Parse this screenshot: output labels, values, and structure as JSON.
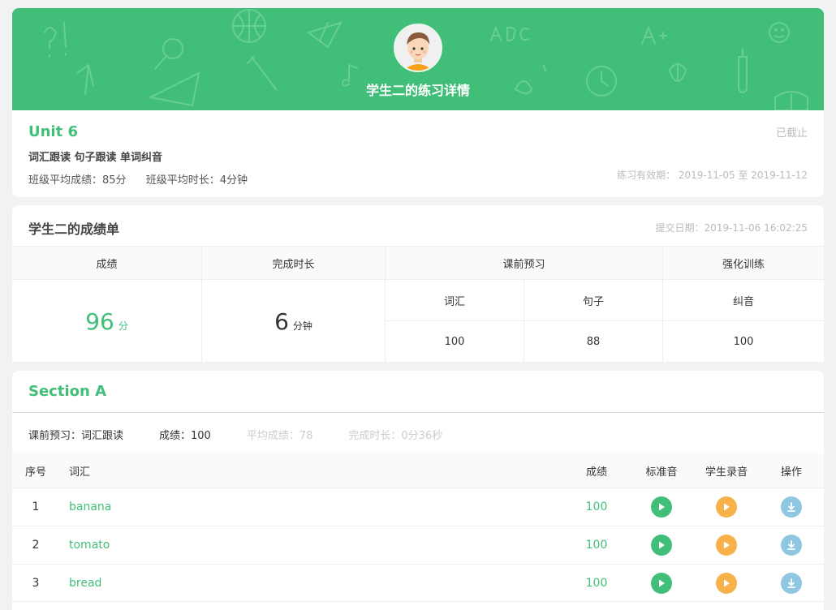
{
  "header": {
    "title": "学生二的练习详情"
  },
  "unit": {
    "title": "Unit 6",
    "types": "词汇跟读 句子跟读 单词纠音",
    "avg_score": "班级平均成绩：85分",
    "avg_time": "班级平均时长：4分钟",
    "status": "已截止",
    "validity": "练习有效期： 2019-11-05 至 2019-11-12"
  },
  "report": {
    "title": "学生二的成绩单",
    "submit_date": "提交日期：2019-11-06 16:02:25",
    "headers": {
      "score": "成绩",
      "duration": "完成时长",
      "preview": "课前预习",
      "training": "强化训练"
    },
    "score_value": "96",
    "score_unit": "分",
    "duration_value": "6",
    "duration_unit": "分钟",
    "preview_items": [
      {
        "label": "词汇",
        "value": "100"
      },
      {
        "label": "句子",
        "value": "88"
      }
    ],
    "training_items": [
      {
        "label": "纠音",
        "value": "100"
      }
    ]
  },
  "section": {
    "title": "Section A",
    "info": {
      "type": "课前预习：词汇跟读",
      "score": "成绩：100",
      "avg": "平均成绩：78",
      "duration": "完成时长：0分36秒"
    },
    "columns": {
      "no": "序号",
      "word": "词汇",
      "score": "成绩",
      "std_audio": "标准音",
      "stu_audio": "学生录音",
      "action": "操作"
    },
    "rows": [
      {
        "no": "1",
        "word": "banana",
        "score": "100"
      },
      {
        "no": "2",
        "word": "tomato",
        "score": "100"
      },
      {
        "no": "3",
        "word": "bread",
        "score": "100"
      }
    ]
  },
  "colors": {
    "accent": "#41bf79",
    "orange": "#f7b24b",
    "blue": "#8fc7e3",
    "muted": "#bbbbbb"
  },
  "icons": [
    "student-avatar-icon",
    "play-icon",
    "download-icon"
  ]
}
